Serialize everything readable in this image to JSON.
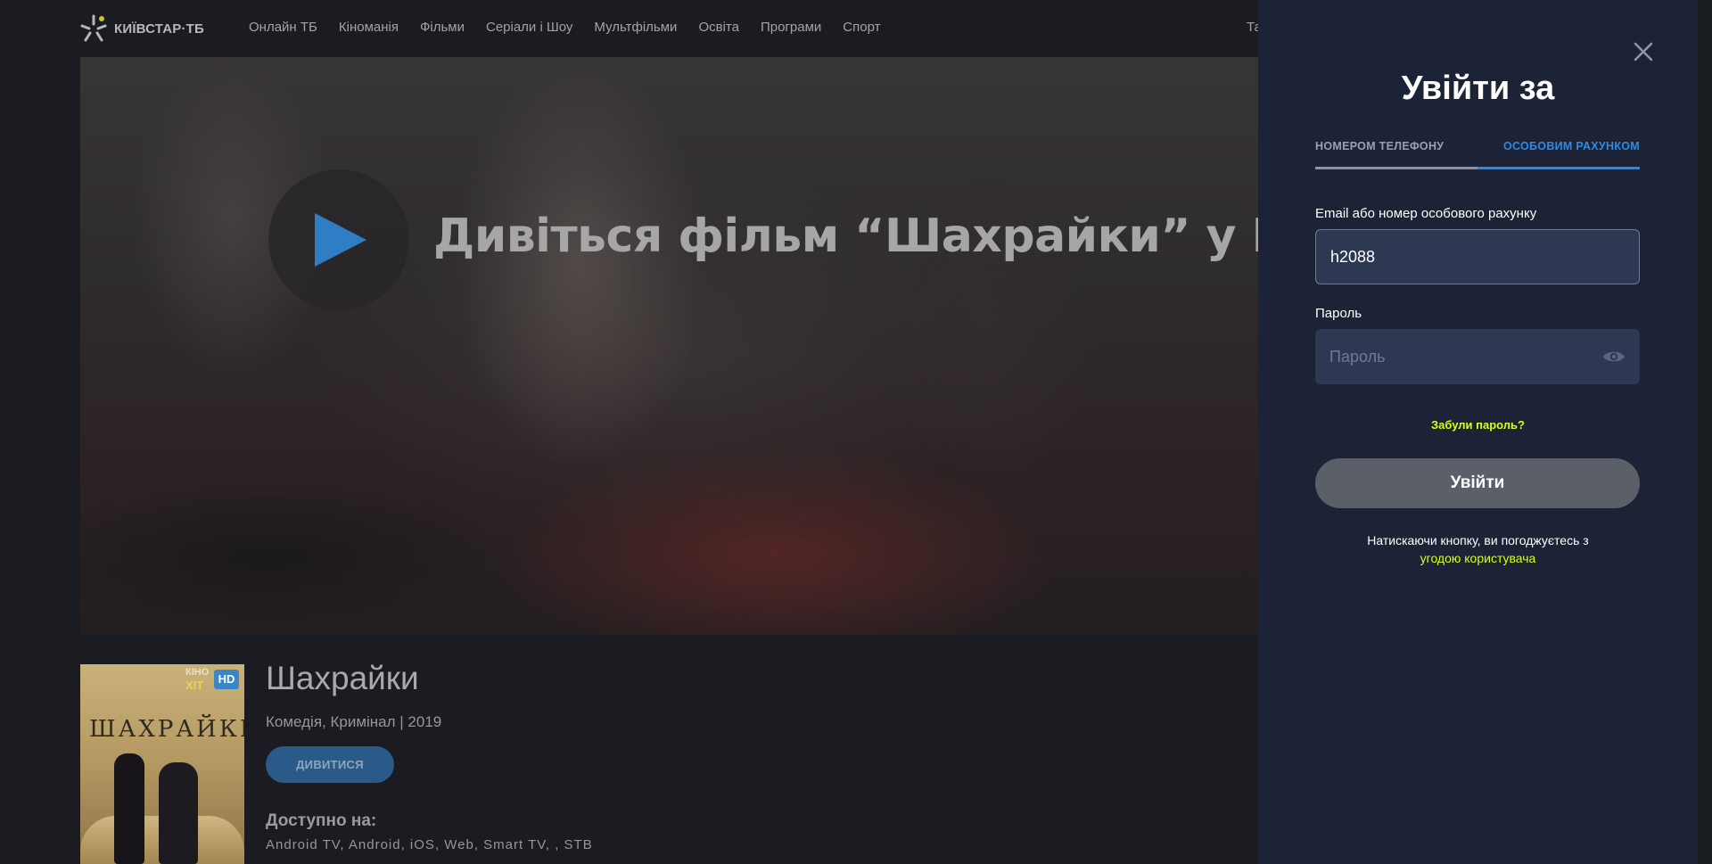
{
  "brand": {
    "logo_text": "КИЇВСТАР·ТБ"
  },
  "nav": {
    "items": [
      "Онлайн ТБ",
      "Кіноманія",
      "Фільми",
      "Серіали і Шоу",
      "Мультфільми",
      "Освіта",
      "Програми",
      "Спорт"
    ],
    "clipped_item": "Та"
  },
  "hero": {
    "title": "Дивіться фільм “Шахрайки” у HD",
    "play_color": "#2f7dc4"
  },
  "movie": {
    "title": "Шахрайки",
    "meta": "Комедія, Кримінал | 2019",
    "watch_label": "ДИВИТИСЯ",
    "available_label": "Доступно на:",
    "available_value": "Android TV, Android, iOS, Web, Smart TV, , STB",
    "poster": {
      "title": "ШАХРАЙКИ",
      "badge_kino": "КІНО",
      "badge_hit": "ХІТ",
      "badge_hd": "HD"
    }
  },
  "login": {
    "title": "Увійти за",
    "tabs": [
      {
        "label": "НОМЕРОМ ТЕЛЕФОНУ",
        "active": false
      },
      {
        "label": "ОСОБОВИМ РАХУНКОМ",
        "active": true
      }
    ],
    "email_label": "Email або номер особового рахунку",
    "email_value": "h2088",
    "password_label": "Пароль",
    "password_placeholder": "Пароль",
    "forgot_label": "Забули пароль?",
    "submit_label": "Увійти",
    "agree_text": "Натискаючи кнопку, ви погоджуєтесь з",
    "agree_link": "угодою користувача",
    "accent_color": "#d8ff17",
    "tab_active_color": "#1f8cf0"
  }
}
